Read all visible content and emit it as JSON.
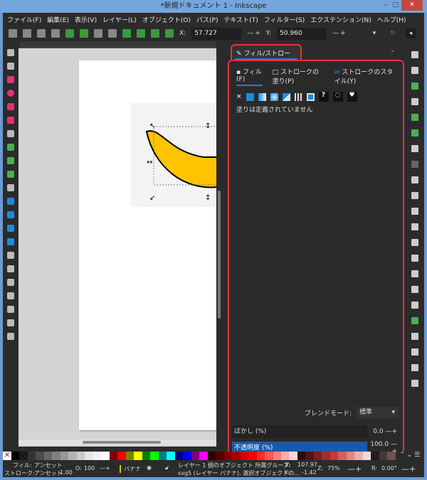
{
  "window": {
    "title": "*新規ドキュメント 1 - Inkscape",
    "minimize": "–",
    "maximize": "□",
    "close": "✕"
  },
  "menu": [
    "ファイル(F)",
    "編集(E)",
    "表示(V)",
    "レイヤー(L)",
    "オブジェクト(O)",
    "パス(P)",
    "テキスト(T)",
    "フィルター(S)",
    "エクステンション(N)",
    "ヘルプ(H)"
  ],
  "toolbar": {
    "x_label": "X:",
    "x_value": "57.727",
    "y_label": "Y:",
    "y_value": "50.960",
    "minus": "—",
    "plus": "+"
  },
  "panel": {
    "tab_label": "フィル/ストローク(F)",
    "tab_close": "×",
    "subtabs": [
      "フィル(F)",
      "ストロークの塗り(P)",
      "ストロークのスタイル(Y)"
    ],
    "paint_icons": [
      "none-icon",
      "flat-color-icon",
      "linear-gradient-icon",
      "radial-gradient-icon",
      "mesh-gradient-icon",
      "pattern-icon",
      "swatch-icon",
      "unset-icon",
      "fill-rule-evenodd-icon",
      "fill-rule-nonzero-icon"
    ],
    "unset_glyph": "?",
    "no_paint_glyph": "×",
    "status": "塗りは定義されていません",
    "blend_label": "ブレンドモード:",
    "blend_value": "標準",
    "blur_label": "ぼかし (%)",
    "blur_value": "0.0",
    "opacity_label": "不透明度 (%)",
    "opacity_value": "100.0"
  },
  "colors": {
    "accent": "#2a7bd6",
    "highlight": "#e8303a",
    "banana": "#ffc400",
    "opacity_bar": "#1a5aa8"
  },
  "palette": [
    "#000000",
    "#1a1a1a",
    "#333333",
    "#4d4d4d",
    "#666666",
    "#808080",
    "#999999",
    "#b3b3b3",
    "#cccccc",
    "#e6e6e6",
    "#f2f2f2",
    "#ffffff",
    "#800000",
    "#ff0000",
    "#808000",
    "#ffff00",
    "#008000",
    "#00ff00",
    "#008080",
    "#00ffff",
    "#000080",
    "#0000ff",
    "#800080",
    "#ff00ff",
    "#2b0000",
    "#550000",
    "#800000",
    "#aa0000",
    "#d40000",
    "#ff0000",
    "#ff2a2a",
    "#ff5555",
    "#ff8080",
    "#ffaaaa",
    "#ffd5d5",
    "#280b0b",
    "#501616",
    "#782121",
    "#a02c2c",
    "#c83737",
    "#d35f5f",
    "#de8787",
    "#e9afaf",
    "#f4d7d7",
    "#241c1c",
    "#483737",
    "#6c5353"
  ],
  "statusbar": {
    "fill_label": "フィル:",
    "fill_value": "アンセット",
    "stroke_label": "ストローク:",
    "stroke_value": "アンセット",
    "stroke_width": "1.00",
    "opacity_label": "O:",
    "opacity_value": "100",
    "layer_name": "バナナ",
    "message_line1": "レイヤー 1 個のオブジェクト 所属グループ:",
    "message_line2": "svg5 (レイヤー バナナ). 選択オブジェクトの…",
    "cx_label": "X:",
    "cx": "107.97",
    "cy_label": "Y:",
    "cy": "-1.42",
    "zoom_label": "Z:",
    "zoom": "75%",
    "rot_label": "R:",
    "rotation": "0.00°"
  }
}
